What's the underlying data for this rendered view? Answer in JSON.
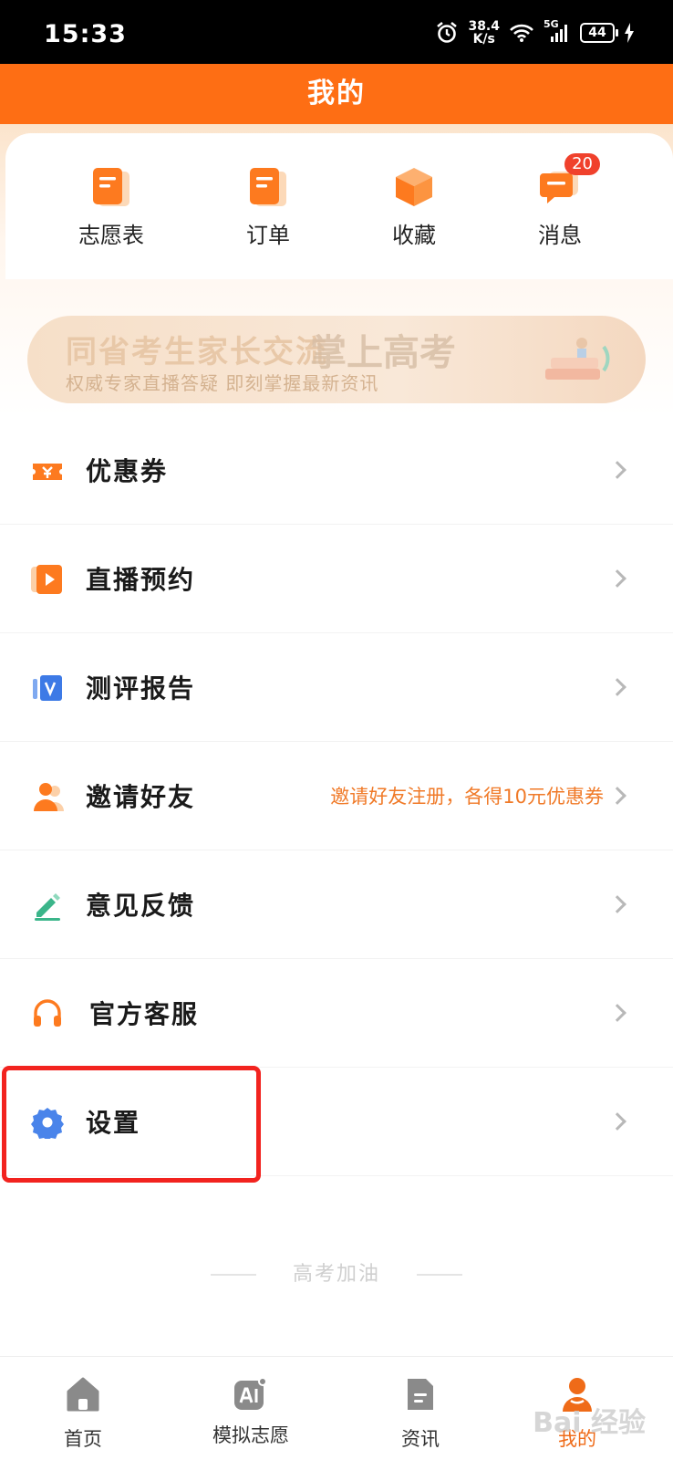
{
  "status_bar": {
    "time": "15:33",
    "speed_value": "38.4",
    "speed_unit": "K/s",
    "network": "5G",
    "battery": "44"
  },
  "header": {
    "title": "我的"
  },
  "quick_actions": [
    {
      "label": "志愿表",
      "icon": "document-icon"
    },
    {
      "label": "订单",
      "icon": "document-icon"
    },
    {
      "label": "收藏",
      "icon": "box-icon"
    },
    {
      "label": "消息",
      "icon": "message-icon",
      "badge": "20"
    }
  ],
  "banner": {
    "title": "同省考生家长交流",
    "subtitle": "权威专家直播答疑 即刻掌握最新资讯",
    "brand": "掌上高考"
  },
  "menu": [
    {
      "label": "优惠券",
      "icon": "coupon-icon"
    },
    {
      "label": "直播预约",
      "icon": "play-icon"
    },
    {
      "label": "测评报告",
      "icon": "report-icon"
    },
    {
      "label": "邀请好友",
      "icon": "person-icon",
      "hint": "邀请好友注册，各得10元优惠券"
    },
    {
      "label": "意见反馈",
      "icon": "edit-icon"
    },
    {
      "label": "官方客服",
      "icon": "headset-icon"
    },
    {
      "label": "设置",
      "icon": "gear-icon"
    }
  ],
  "footer_note": "高考加油",
  "tabs": [
    {
      "label": "首页",
      "icon": "home-icon"
    },
    {
      "label": "模拟志愿",
      "icon": "ai-icon"
    },
    {
      "label": "资讯",
      "icon": "news-icon"
    },
    {
      "label": "我的",
      "icon": "profile-icon",
      "active": true
    }
  ],
  "watermark": "Bai 经验",
  "colors": {
    "brand": "#fe6e14",
    "highlight": "#f2231f",
    "hint": "#f07a28",
    "badge": "#f0412c"
  }
}
